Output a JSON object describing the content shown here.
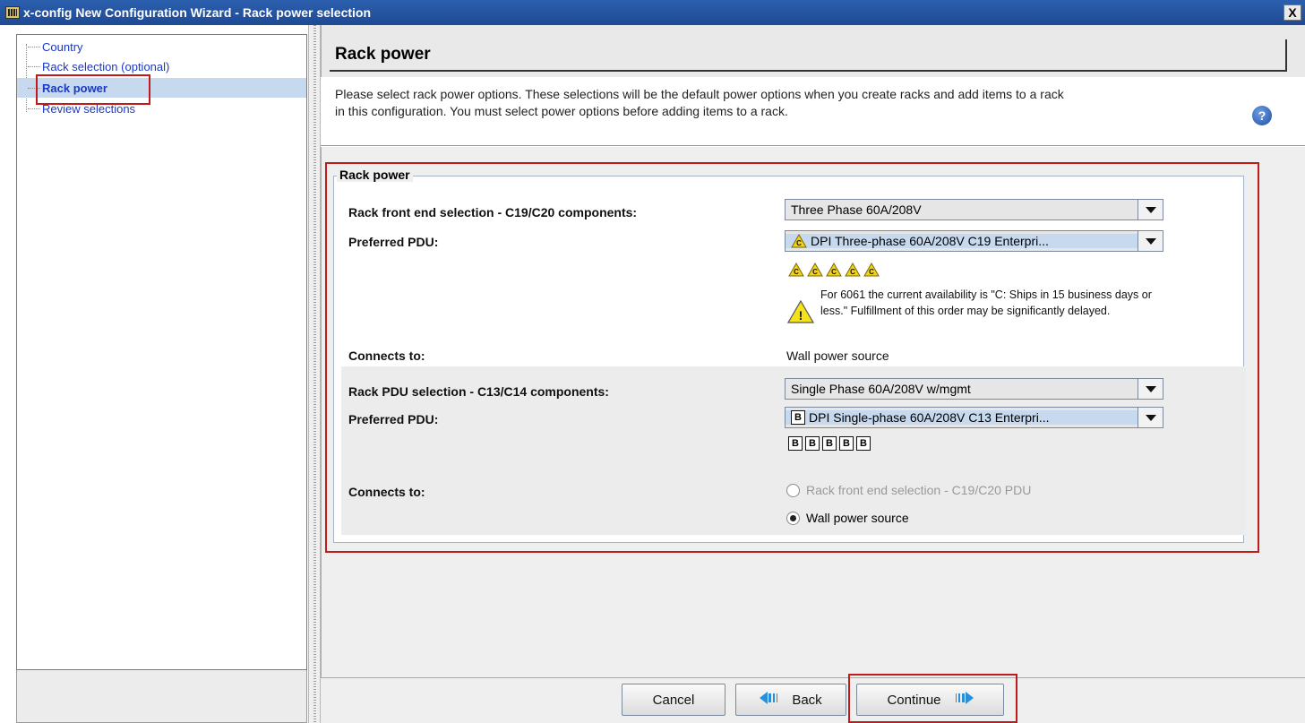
{
  "window": {
    "title": "x-config New Configuration Wizard - Rack power selection",
    "close_label": "X"
  },
  "sidebar": {
    "items": [
      {
        "label": "Country"
      },
      {
        "label": "Rack selection (optional)"
      },
      {
        "label": "Rack power",
        "selected": true
      },
      {
        "label": "Review selections"
      }
    ]
  },
  "main": {
    "title": "Rack power",
    "intro": "Please select rack power options. These selections will be the default power options when you create racks and add items to a rack in this configuration. You must select power options before adding items to a rack.",
    "help_label": "?"
  },
  "rack_power": {
    "group_title": "Rack power",
    "front_end": {
      "label": "Rack front end selection - C19/C20 components:",
      "value": "Three Phase 60A/208V",
      "pdu_label": "Preferred PDU:",
      "pdu_value": "DPI Three-phase 60A/208V C19 Enterpri...",
      "pdu_badge": "C",
      "badge_count": 5,
      "warning": "For 6061 the current availability is \"C: Ships in 15 business days or less.\" Fulfillment of this order may be significantly delayed.",
      "connects_label": "Connects to:",
      "connects_value": "Wall power source"
    },
    "pdu_selection": {
      "label": "Rack PDU selection - C13/C14 components:",
      "value": "Single Phase 60A/208V w/mgmt",
      "pdu_label": "Preferred PDU:",
      "pdu_value": "DPI Single-phase 60A/208V C13 Enterpri...",
      "pdu_badge": "B",
      "badge_count": 5,
      "connects_label": "Connects to:",
      "radio_options": [
        {
          "label": "Rack front end selection - C19/C20 PDU",
          "checked": false,
          "disabled": true
        },
        {
          "label": "Wall power source",
          "checked": true,
          "disabled": false
        }
      ]
    }
  },
  "footer": {
    "cancel_label": "Cancel",
    "back_label": "Back",
    "continue_label": "Continue"
  },
  "colors": {
    "title_bar": "#2b5fae",
    "highlight": "#c01b1b",
    "selection": "#c6d9ee",
    "link": "#1a39c4"
  }
}
